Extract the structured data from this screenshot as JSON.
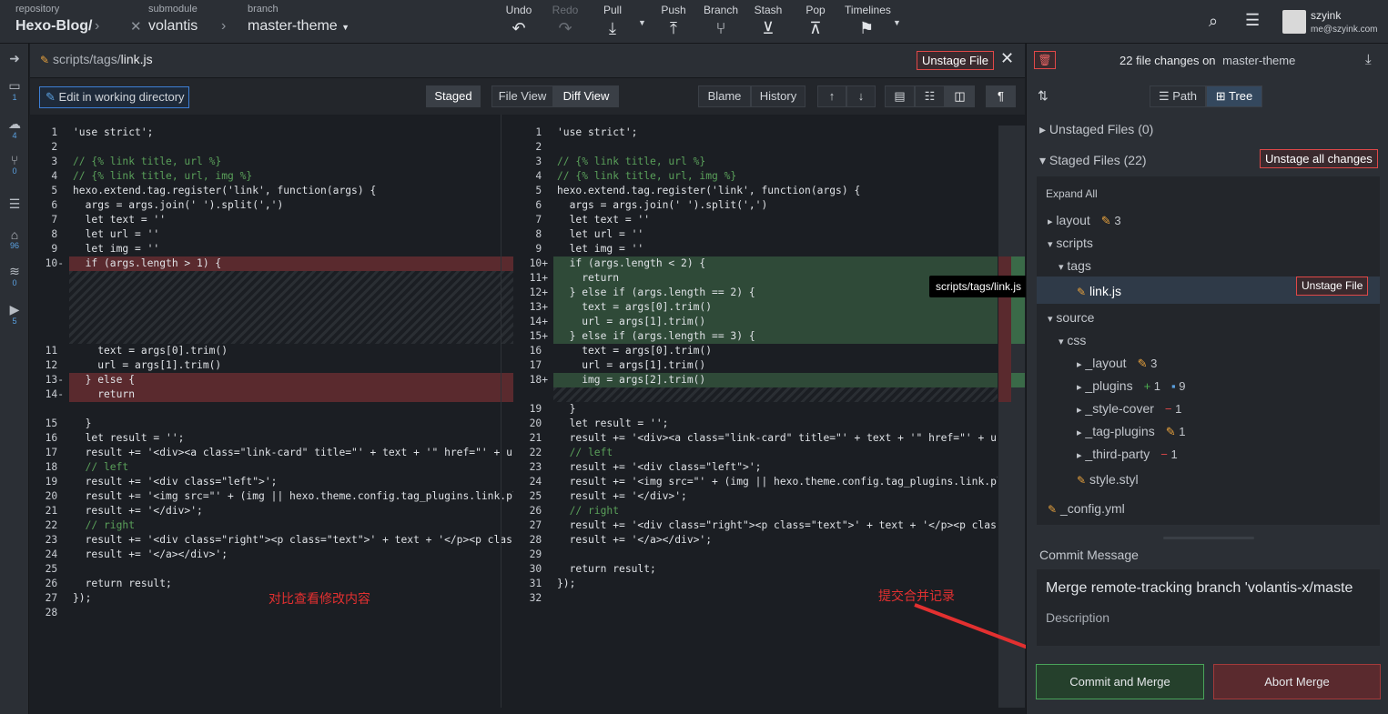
{
  "toolbar": {
    "repo_label": "repository",
    "repo": "Hexo-Blog/",
    "sub_label": "submodule",
    "sub": "volantis",
    "branch_label": "branch",
    "branch": "master-theme",
    "actions": [
      "Undo",
      "Redo",
      "Pull",
      "Push",
      "Branch",
      "Stash",
      "Pop",
      "Timelines"
    ],
    "user": "szyink",
    "email": "me@szyink.com"
  },
  "leftbar": {
    "counts": [
      "1",
      "4",
      "0",
      "96",
      "0",
      "5"
    ]
  },
  "diff": {
    "path_prefix": "scripts/tags/",
    "file": "link.js",
    "unstage": "Unstage File",
    "edit": "Edit in working directory",
    "staged": "Staged",
    "file_view": "File View",
    "diff_view": "Diff View",
    "blame": "Blame",
    "history": "History"
  },
  "left_lines": [
    [
      "1",
      "",
      "'use strict';"
    ],
    [
      "2",
      "",
      ""
    ],
    [
      "3",
      "",
      "// {% link title, url %}"
    ],
    [
      "4",
      "",
      "// {% link title, url, img %}"
    ],
    [
      "5",
      "",
      "hexo.extend.tag.register('link', function(args) {"
    ],
    [
      "6",
      "",
      "  args = args.join(' ').split(',')"
    ],
    [
      "7",
      "",
      "  let text = ''"
    ],
    [
      "8",
      "",
      "  let url = ''"
    ],
    [
      "9",
      "",
      "  let img = ''"
    ],
    [
      "10",
      "-",
      "  if (args.length > 1) {"
    ],
    [
      "11",
      "",
      "    text = args[0].trim()"
    ],
    [
      "12",
      "",
      "    url = args[1].trim()"
    ],
    [
      "13",
      "-",
      "  } else {"
    ],
    [
      "14",
      "-",
      "    return"
    ],
    [
      "15",
      "",
      "  }"
    ],
    [
      "16",
      "",
      "  let result = '';"
    ],
    [
      "17",
      "",
      "  result += '<div><a class=\"link-card\" title=\"' + text + '\" href=\"' + url"
    ],
    [
      "18",
      "",
      "  // left"
    ],
    [
      "19",
      "",
      "  result += '<div class=\"left\">';"
    ],
    [
      "20",
      "",
      "  result += '<img src=\"' + (img || hexo.theme.config.tag_plugins.link.plac"
    ],
    [
      "21",
      "",
      "  result += '</div>';"
    ],
    [
      "22",
      "",
      "  // right"
    ],
    [
      "23",
      "",
      "  result += '<div class=\"right\"><p class=\"text\">' + text + '</p><p class=\""
    ],
    [
      "24",
      "",
      "  result += '</a></div>';"
    ],
    [
      "25",
      "",
      ""
    ],
    [
      "26",
      "",
      "  return result;"
    ],
    [
      "27",
      "",
      "});"
    ],
    [
      "28",
      "",
      ""
    ]
  ],
  "right_lines": [
    [
      "1",
      "",
      "'use strict';"
    ],
    [
      "2",
      "",
      ""
    ],
    [
      "3",
      "",
      "// {% link title, url %}"
    ],
    [
      "4",
      "",
      "// {% link title, url, img %}"
    ],
    [
      "5",
      "",
      "hexo.extend.tag.register('link', function(args) {"
    ],
    [
      "6",
      "",
      "  args = args.join(' ').split(',')"
    ],
    [
      "7",
      "",
      "  let text = ''"
    ],
    [
      "8",
      "",
      "  let url = ''"
    ],
    [
      "9",
      "",
      "  let img = ''"
    ],
    [
      "10",
      "+",
      "  if (args.length < 2) {"
    ],
    [
      "11",
      "+",
      "    return"
    ],
    [
      "12",
      "+",
      "  } else if (args.length == 2) {"
    ],
    [
      "13",
      "+",
      "    text = args[0].trim()"
    ],
    [
      "14",
      "+",
      "    url = args[1].trim()"
    ],
    [
      "15",
      "+",
      "  } else if (args.length == 3) {"
    ],
    [
      "16",
      "",
      "    text = args[0].trim()"
    ],
    [
      "17",
      "",
      "    url = args[1].trim()"
    ],
    [
      "18",
      "+",
      "    img = args[2].trim()"
    ],
    [
      "19",
      "",
      "  }"
    ],
    [
      "20",
      "",
      "  let result = '';"
    ],
    [
      "21",
      "",
      "  result += '<div><a class=\"link-card\" title=\"' + text + '\" href=\"' + url"
    ],
    [
      "22",
      "",
      "  // left"
    ],
    [
      "23",
      "",
      "  result += '<div class=\"left\">';"
    ],
    [
      "24",
      "",
      "  result += '<img src=\"' + (img || hexo.theme.config.tag_plugins.link.plac"
    ],
    [
      "25",
      "",
      "  result += '</div>';"
    ],
    [
      "26",
      "",
      "  // right"
    ],
    [
      "27",
      "",
      "  result += '<div class=\"right\"><p class=\"text\">' + text + '</p><p class=\""
    ],
    [
      "28",
      "",
      "  result += '</a></div>';"
    ],
    [
      "29",
      "",
      ""
    ],
    [
      "30",
      "",
      "  return result;"
    ],
    [
      "31",
      "",
      "});"
    ],
    [
      "32",
      "",
      ""
    ]
  ],
  "tooltip": "scripts/tags/link.js",
  "annotations": {
    "left": "对比查看修改内容",
    "right": "提交合并记录"
  },
  "panel": {
    "changes": "22 file changes on",
    "branch": "master-theme",
    "path": "Path",
    "tree": "Tree",
    "unstaged": "Unstaged Files (0)",
    "staged": "Staged Files (22)",
    "unstage_all": "Unstage all changes",
    "expand": "Expand All",
    "tree_items": [
      {
        "name": "layout",
        "badges": [
          [
            "pen",
            "3"
          ]
        ]
      },
      {
        "name": "scripts"
      },
      {
        "name": "tags"
      },
      {
        "name": "link.js"
      },
      {
        "name": "source"
      },
      {
        "name": "css"
      },
      {
        "name": "_layout",
        "badges": [
          [
            "pen",
            "3"
          ]
        ]
      },
      {
        "name": "_plugins",
        "badges": [
          [
            "plus",
            "1"
          ],
          [
            "mod",
            "9"
          ]
        ]
      },
      {
        "name": "_style-cover",
        "badges": [
          [
            "minus",
            "1"
          ]
        ]
      },
      {
        "name": "_tag-plugins",
        "badges": [
          [
            "pen",
            "1"
          ]
        ]
      },
      {
        "name": "_third-party",
        "badges": [
          [
            "minus",
            "1"
          ]
        ]
      },
      {
        "name": "style.styl"
      },
      {
        "name": "_config.yml"
      }
    ],
    "unstage_file": "Unstage File",
    "commit_label": "Commit Message",
    "commit_msg": "Merge remote-tracking branch 'volantis-x/maste",
    "description": "Description",
    "commit_btn": "Commit and Merge",
    "abort_btn": "Abort Merge"
  }
}
